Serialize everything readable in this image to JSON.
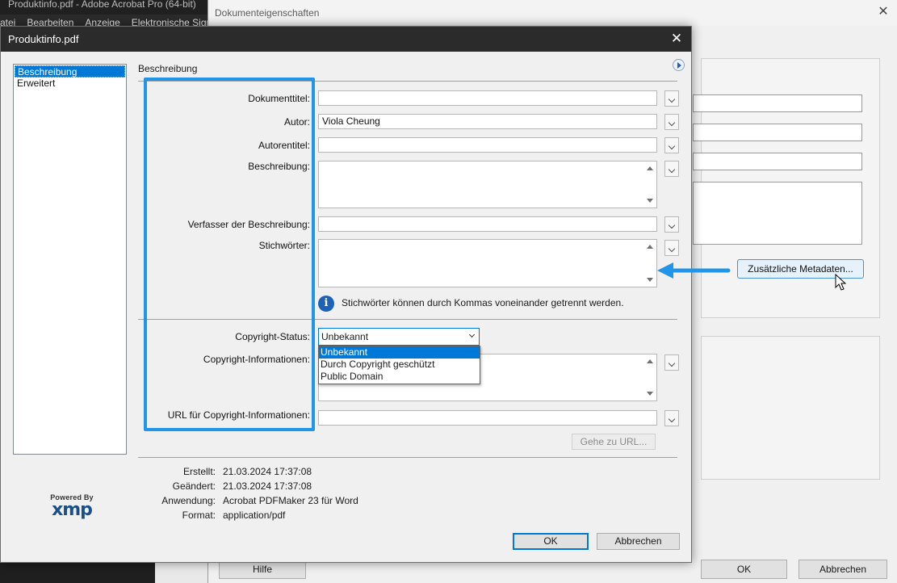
{
  "app": {
    "window_title": "Produktinfo.pdf - Adobe Acrobat Pro (64-bit)",
    "menu": [
      "atei",
      "Bearbeiten",
      "Anzeige",
      "Elektronische Signa"
    ]
  },
  "props_window": {
    "title": "Dokumenteigenschaften",
    "additional_metadata_button": "Zusätzliche Metadaten...",
    "help_button": "Hilfe",
    "ok_button": "OK",
    "cancel_button": "Abbrechen"
  },
  "dialog": {
    "title": "Produktinfo.pdf",
    "nav": [
      "Beschreibung",
      "Erweitert"
    ],
    "section_title": "Beschreibung",
    "fields": {
      "doc_title_label": "Dokumenttitel:",
      "doc_title_value": "",
      "author_label": "Autor:",
      "author_value": "Viola Cheung",
      "author_title_label": "Autorentitel:",
      "author_title_value": "",
      "description_label": "Beschreibung:",
      "description_writer_label": "Verfasser der Beschreibung:",
      "keywords_label": "Stichwörter:",
      "keywords_hint": "Stichwörter können durch Kommas voneinander getrennt werden.",
      "copyright_status_label": "Copyright-Status:",
      "copyright_status_value": "Unbekannt",
      "copyright_options": [
        "Unbekannt",
        "Durch Copyright geschützt",
        "Public Domain"
      ],
      "copyright_info_label": "Copyright-Informationen:",
      "copyright_url_label": "URL für Copyright-Informationen:",
      "goto_url_button": "Gehe zu URL..."
    },
    "meta": {
      "created_label": "Erstellt:",
      "created_value": "21.03.2024 17:37:08",
      "modified_label": "Geändert:",
      "modified_value": "21.03.2024 17:37:08",
      "application_label": "Anwendung:",
      "application_value": "Acrobat PDFMaker 23 für Word",
      "format_label": "Format:",
      "format_value": "application/pdf"
    },
    "ok_button": "OK",
    "cancel_button": "Abbrechen",
    "powered_by": "Powered By",
    "xmp_logo": "xmp"
  },
  "colors": {
    "highlight": "#2196e8",
    "selection": "#0078d7"
  }
}
